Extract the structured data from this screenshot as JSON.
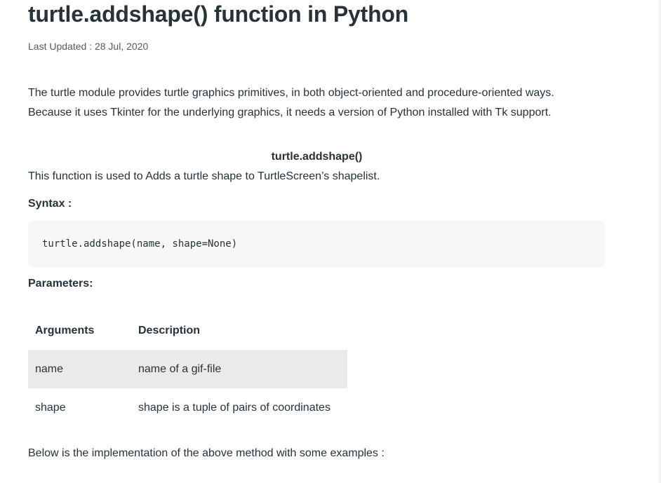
{
  "article": {
    "title": "turtle.addshape() function in Python",
    "last_updated": "Last Updated : 28 Jul, 2020",
    "intro": "The turtle module provides turtle graphics primitives, in both object-oriented and procedure-oriented ways. Because it uses Tkinter for the underlying graphics, it needs a version of Python installed with Tk support.",
    "function_heading": "turtle.addshape()",
    "function_description": "This function is used to Adds a turtle shape to TurtleScreen’s shapelist.",
    "syntax_label": "Syntax :",
    "syntax_code": "turtle.addshape(name, shape=None)",
    "parameters_label": "Parameters:",
    "parameters_table": {
      "headers": [
        "Arguments",
        "Description"
      ],
      "rows": [
        {
          "argument": "name",
          "description": "name of a gif-file"
        },
        {
          "argument": "shape",
          "description": "shape is a tuple of pairs of coordinates"
        }
      ]
    },
    "below_text": "Below is the implementation of the above method with some examples :"
  },
  "colors": {
    "text": "#273239",
    "meta_text": "#5a5a5a",
    "code_background": "#f7f7f7",
    "shaded_row": "#eaeaea"
  }
}
